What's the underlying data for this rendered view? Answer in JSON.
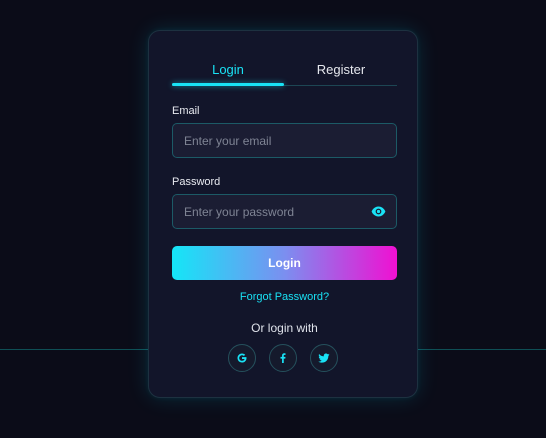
{
  "tabs": {
    "login_label": "Login",
    "register_label": "Register",
    "active": "Login"
  },
  "form": {
    "email_label": "Email",
    "email_placeholder": "Enter your email",
    "email_value": "",
    "password_label": "Password",
    "password_placeholder": "Enter your password",
    "password_value": "",
    "submit_label": "Login",
    "forgot_label": "Forgot Password?"
  },
  "social": {
    "heading": "Or login with",
    "providers": [
      {
        "name": "google",
        "icon": "google-icon"
      },
      {
        "name": "facebook",
        "icon": "facebook-icon"
      },
      {
        "name": "twitter",
        "icon": "twitter-icon"
      }
    ]
  },
  "colors": {
    "background": "#0b0c18",
    "card": "#12152a",
    "accent_cyan": "#19e2f5",
    "accent_magenta": "#f010d2"
  }
}
